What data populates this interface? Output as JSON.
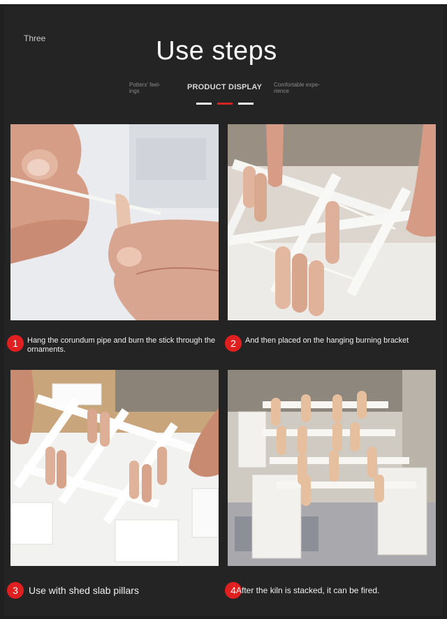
{
  "header": {
    "eyebrow": "Three",
    "title": "Use steps",
    "nav_left": "Potters' feel-\nings",
    "nav_active": "PRODUCT DISPLAY",
    "nav_right": "Comfortable expe-\nrience"
  },
  "steps": [
    {
      "number": "1",
      "text": "Hang the corundum pipe and burn the stick through the ornaments."
    },
    {
      "number": "2",
      "text": "And then placed on the hanging burning bracket"
    },
    {
      "number": "3",
      "text": "Use with shed slab pillars"
    },
    {
      "number": "4",
      "text": "After the kiln is stacked, it can be fired."
    }
  ],
  "colors": {
    "background": "#242424",
    "accent_red": "#e02020",
    "text": "#ffffff"
  }
}
